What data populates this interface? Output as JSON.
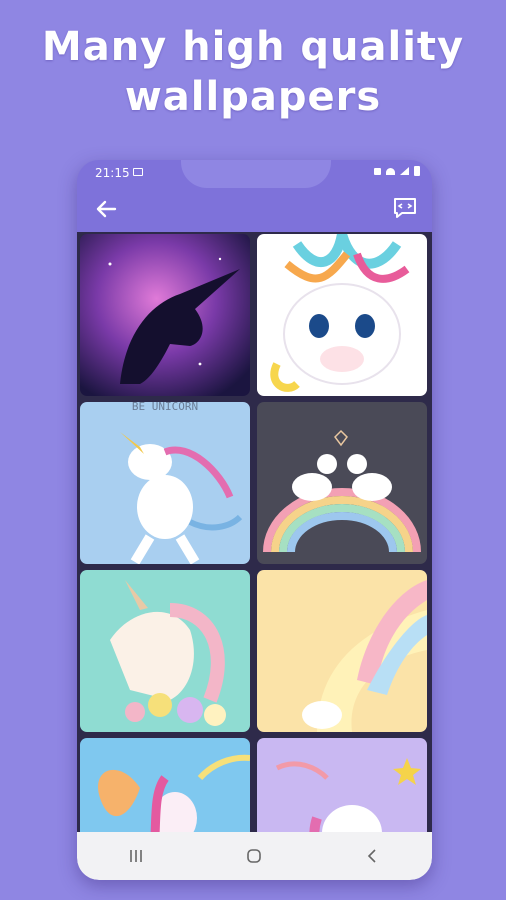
{
  "headline": {
    "line1": "Many high quality",
    "line2": "wallpapers"
  },
  "status_bar": {
    "time": "21:15",
    "icons": [
      "image-icon",
      "sound-icon",
      "wifi-icon",
      "signal-icon",
      "battery-icon"
    ]
  },
  "app_bar": {
    "back_icon": "arrow-left-icon",
    "action_icon": "feedback-icon"
  },
  "wallpapers": [
    {
      "name": "galaxy-unicorn"
    },
    {
      "name": "cute-unicorn-face"
    },
    {
      "name": "dabbing-unicorn",
      "caption": "BE UNICORN"
    },
    {
      "name": "rainbow-unicorns"
    },
    {
      "name": "floral-unicorn"
    },
    {
      "name": "pastel-unicorn"
    },
    {
      "name": "winged-unicorn"
    },
    {
      "name": "star-unicorn"
    }
  ],
  "nav_bar": {
    "buttons": [
      "recents-icon",
      "home-icon",
      "back-icon"
    ]
  },
  "colors": {
    "background": "#8f86e3",
    "app_bar": "#7e72da",
    "headline": "#ffffff"
  }
}
